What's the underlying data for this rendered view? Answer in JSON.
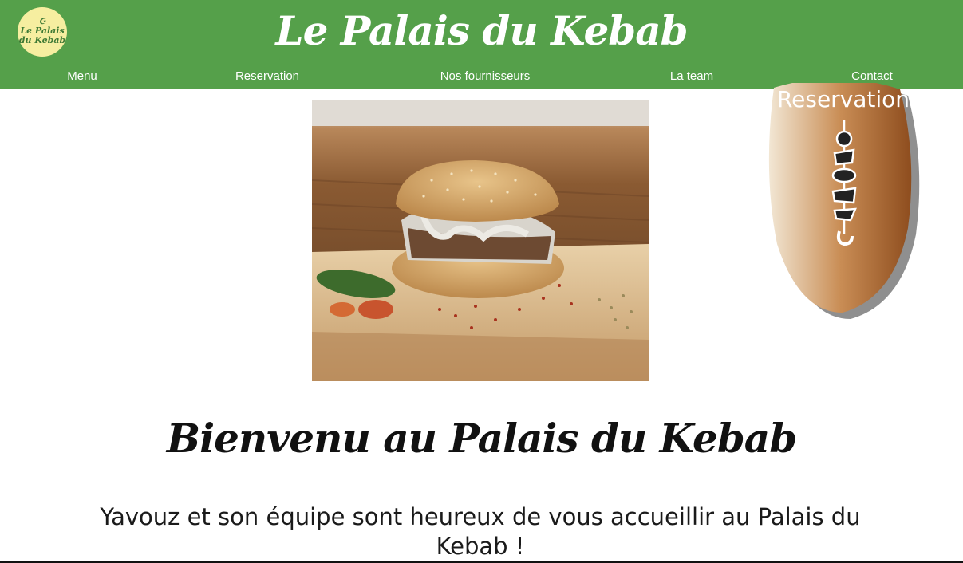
{
  "header": {
    "logo_line1": "Le Palais",
    "logo_line2": "du Kebab",
    "title": "Le Palais du Kebab",
    "bg_color": "#55a04a"
  },
  "nav": {
    "items": [
      {
        "label": "Menu"
      },
      {
        "label": "Reservation"
      },
      {
        "label": "Nos fournisseurs"
      },
      {
        "label": "La team"
      },
      {
        "label": "Contact"
      }
    ]
  },
  "floating_button": {
    "label": "Reservation",
    "icon": "kebab-skewer-icon"
  },
  "main": {
    "hero_image": "kebab-burger-photo",
    "heading": "Bienvenu au Palais du Kebab",
    "intro": "Yavouz et son équipe sont heureux de vous accueillir au Palais du Kebab !"
  }
}
